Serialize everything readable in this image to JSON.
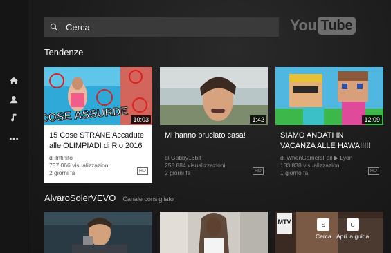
{
  "search": {
    "placeholder": "Cerca"
  },
  "logo": {
    "you": "You",
    "tube": "Tube"
  },
  "sidebar": {
    "items": [
      "home-icon",
      "account-icon",
      "music-icon",
      "more-icon"
    ]
  },
  "trending": {
    "title": "Tendenze",
    "videos": [
      {
        "thumb_text": "COSE ASSURDE",
        "duration": "10:03",
        "title": "15 Cose STRANE Accadute alle OLIMPIADI di Rio 2016",
        "channel": "di Infinito",
        "views": "757.066 visualizzazioni",
        "age": "2 giorni fa",
        "badge": "HD",
        "focused": true
      },
      {
        "duration": "1:42",
        "title": "Mi hanno bruciato casa!",
        "channel": "di Gabby16bit",
        "views": "258.884 visualizzazioni",
        "age": "2 giorni fa",
        "badge": "HD",
        "focused": false
      },
      {
        "duration": "12:09",
        "title": "SIAMO ANDATI IN VACANZA ALLE HAWAII!!!",
        "channel": "di WhenGamersFail ▶ Lyon",
        "views": "133.838 visualizzazioni",
        "age": "1 giorno fa",
        "badge": "HD",
        "focused": false
      }
    ]
  },
  "recommended": {
    "title": "AlvaroSolerVEVO",
    "subtitle": "Canale consigliato"
  },
  "overlay": {
    "search_key": "S",
    "search_label": "Cerca",
    "guide_key": "G",
    "guide_label": "Apri la guida",
    "mtv_logo": "MTV"
  }
}
